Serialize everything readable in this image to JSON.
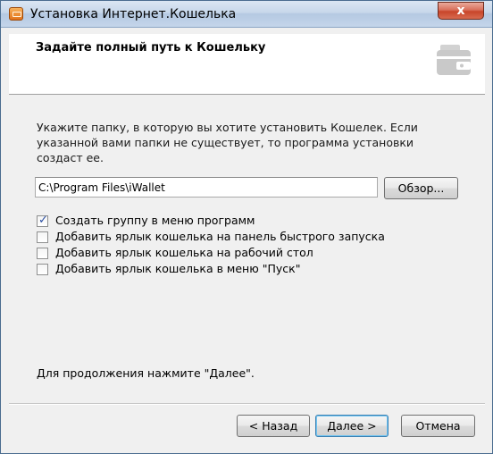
{
  "window": {
    "title": "Установка Интернет.Кошелька",
    "close_label": "x"
  },
  "header": {
    "title": "Задайте полный путь к Кошельку"
  },
  "description": "Укажите папку, в которую вы хотите установить Кошелек. Если указанной вами папки не существует, то программа установки создаст ее.",
  "path_input": {
    "value": "C:\\Program Files\\iWallet"
  },
  "browse_label": "Обзор...",
  "options": [
    {
      "label": "Создать группу в меню программ",
      "checked": true
    },
    {
      "label": "Добавить ярлык кошелька на панель быстрого запуска",
      "checked": false
    },
    {
      "label": "Добавить ярлык кошелька на рабочий стол",
      "checked": false
    },
    {
      "label": "Добавить ярлык кошелька в меню \"Пуск\"",
      "checked": false
    }
  ],
  "footer_hint": "Для продолжения нажмите \"Далее\".",
  "buttons": {
    "back": "< Назад",
    "next": "Далее >",
    "cancel": "Отмена"
  },
  "icons": {
    "app": "wallet-app-icon",
    "header": "wallet-icon",
    "close": "close-icon",
    "check": "checkmark-icon"
  }
}
